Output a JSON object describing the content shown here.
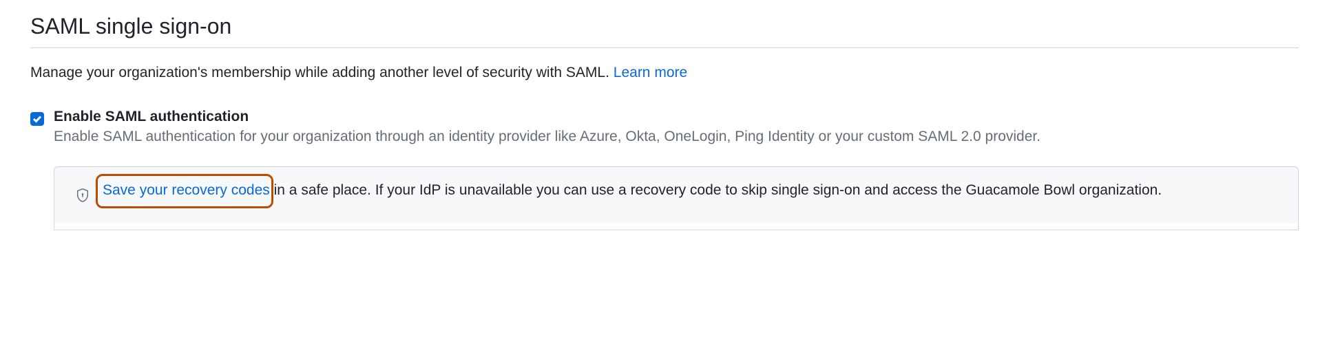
{
  "heading": "SAML single sign-on",
  "intro": {
    "text": "Manage your organization's membership while adding another level of security with SAML. ",
    "link": "Learn more"
  },
  "checkbox": {
    "checked": true,
    "label": "Enable SAML authentication",
    "description": "Enable SAML authentication for your organization through an identity provider like Azure, Okta, OneLogin, Ping Identity or your custom SAML 2.0 provider."
  },
  "note": {
    "link_text": "Save your recovery codes",
    "rest": " in a safe place. If your IdP is unavailable you can use a recovery code to skip single sign-on and access the Guacamole Bowl organization."
  }
}
